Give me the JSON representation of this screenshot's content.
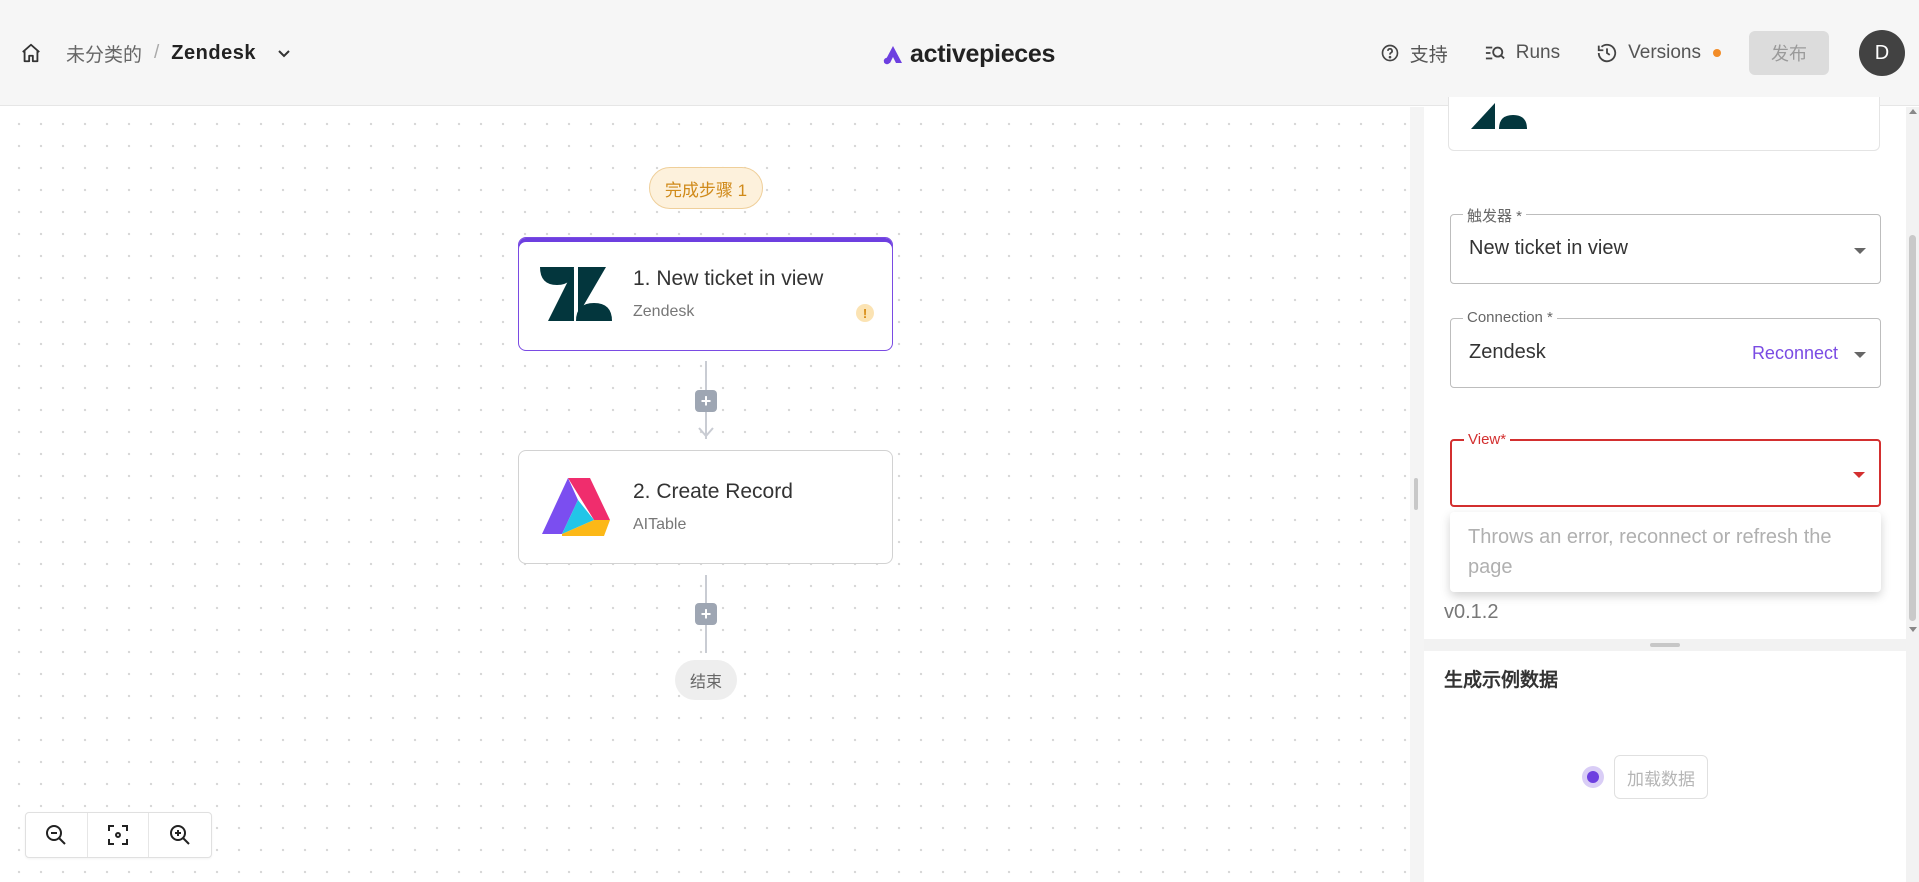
{
  "header": {
    "breadcrumb_folder": "未分类的",
    "breadcrumb_separator": "/",
    "flow_name": "Zendesk",
    "brand_name": "activepieces",
    "support_label": "支持",
    "runs_label": "Runs",
    "versions_label": "Versions",
    "publish_label": "发布",
    "avatar_initial": "D",
    "versions_dot_color": "#f28c28"
  },
  "canvas": {
    "status_pill": "完成步骤 1",
    "steps": [
      {
        "title": "1. New ticket in view",
        "subtitle": "Zendesk",
        "warning": "!"
      },
      {
        "title": "2. Create Record",
        "subtitle": "AITable"
      }
    ],
    "add_button": "+",
    "end_label": "结束"
  },
  "panel": {
    "trigger_label": "触发器 *",
    "trigger_value": "New ticket in view",
    "connection_label": "Connection *",
    "connection_value": "Zendesk",
    "reconnect_label": "Reconnect",
    "view_label": "View*",
    "view_value": "",
    "dropdown_message": "Throws an error, reconnect or refresh the page",
    "version": "v0.1.2",
    "sample_data_title": "生成示例数据",
    "load_data_label": "加载数据"
  },
  "colors": {
    "accent": "#6d3fe0",
    "error": "#d32f2f",
    "warning": "#d68a12"
  }
}
